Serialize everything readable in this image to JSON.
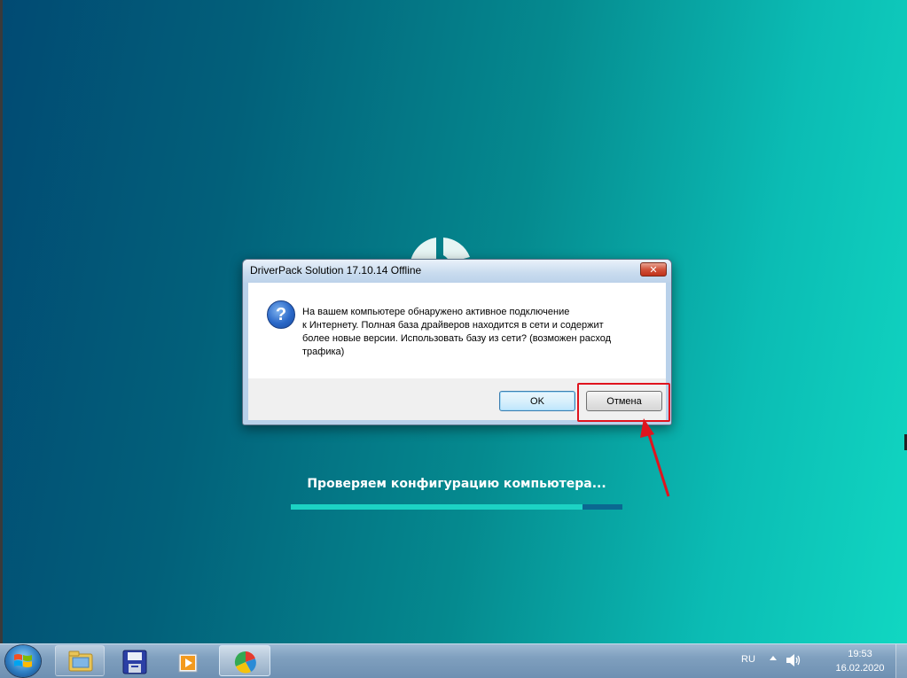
{
  "dialog": {
    "title": "DriverPack Solution 17.10.14 Offline",
    "close_label": "✕",
    "icon": "question-icon",
    "message_lines": [
      "На вашем компьютере обнаружено активное подключение",
      "к Интернету. Полная база драйверов находится в сети и содержит",
      "более новые версии. Использовать базу из сети? (возможен расход",
      "трафика)"
    ],
    "ok_label": "OK",
    "cancel_label": "Отмена"
  },
  "splash": {
    "status": "Проверяем конфигурацию компьютера...",
    "progress": 0.88
  },
  "taskbar": {
    "apps": [
      "explorer-icon",
      "save-icon",
      "media-player-icon",
      "driverpack-icon"
    ],
    "language": "RU",
    "time": "19:53",
    "date": "16.02.2020"
  },
  "colors": {
    "annotation": "#e0141e",
    "progress_fill": "#1cd3c4",
    "progress_track": "#0b6891"
  }
}
